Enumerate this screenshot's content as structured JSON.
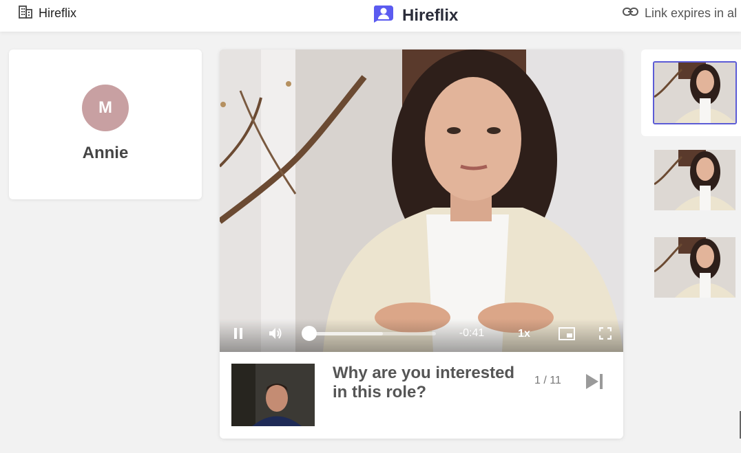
{
  "header": {
    "company_name": "Hireflix",
    "brand_name": "Hireflix",
    "expiry_text": "Link expires in al",
    "icons": {
      "company": "building-icon",
      "brand": "hireflix-logo-icon",
      "expiry": "link-icon"
    },
    "brand_color": "#5b5bf0"
  },
  "candidate": {
    "initial": "M",
    "name": "Annie",
    "avatar_color": "#c8a0a2"
  },
  "player": {
    "time_remaining": "-0:41",
    "speed": "1x",
    "progress_fraction": 0.0,
    "buffered_fraction": 0.58,
    "icons": [
      "pause-icon",
      "volume-icon",
      "picture-in-picture-icon",
      "fullscreen-icon"
    ]
  },
  "question": {
    "text": "Why are you interested in this role?",
    "counter": "1 / 11",
    "next_icon": "skip-next-icon"
  },
  "thumbnails": {
    "count": 3,
    "active_index": 0,
    "active_color": "#5b5bd6"
  }
}
